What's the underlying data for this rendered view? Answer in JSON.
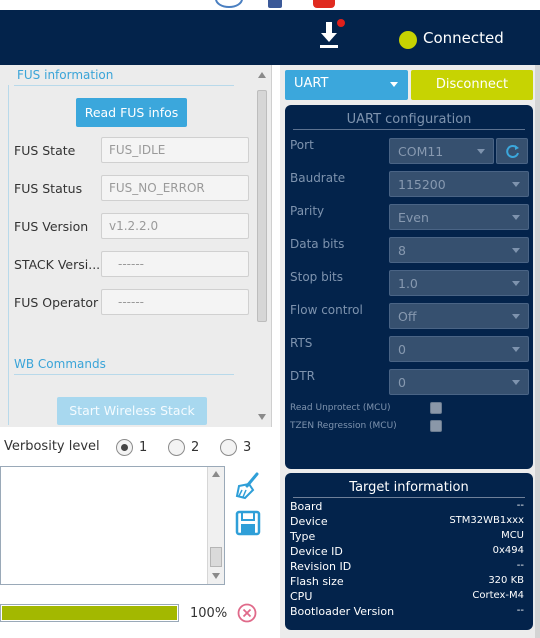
{
  "header": {
    "connection_status": "Connected",
    "status_color": "#c7d302",
    "download_icon": "download-icon"
  },
  "fus": {
    "section_title": "FUS information",
    "read_button": "Read FUS infos",
    "fields": [
      {
        "label": "FUS State",
        "value": "FUS_IDLE"
      },
      {
        "label": "FUS Status",
        "value": "FUS_NO_ERROR"
      },
      {
        "label": "FUS Version",
        "value": "v1.2.2.0"
      },
      {
        "label": "STACK Versi...",
        "value": "------"
      },
      {
        "label": "FUS Operator",
        "value": "------"
      }
    ]
  },
  "wb": {
    "section_title": "WB Commands",
    "start_button": "Start Wireless Stack"
  },
  "verbosity": {
    "label": "Verbosity level",
    "options": [
      "1",
      "2",
      "3"
    ],
    "selected": "1"
  },
  "progress": {
    "percent_text": "100%",
    "fraction": 1.0,
    "color": "#a3b800"
  },
  "connection": {
    "interface": "UART",
    "disconnect_button": "Disconnect"
  },
  "uart": {
    "title": "UART configuration",
    "fields": [
      {
        "label": "Port",
        "value": "COM11"
      },
      {
        "label": "Baudrate",
        "value": "115200"
      },
      {
        "label": "Parity",
        "value": "Even"
      },
      {
        "label": "Data bits",
        "value": "8"
      },
      {
        "label": "Stop bits",
        "value": "1.0"
      },
      {
        "label": "Flow control",
        "value": "Off"
      },
      {
        "label": "RTS",
        "value": "0"
      },
      {
        "label": "DTR",
        "value": "0"
      }
    ],
    "checkboxes": [
      {
        "label": "Read Unprotect (MCU)",
        "checked": false
      },
      {
        "label": "TZEN Regression (MCU)",
        "checked": false
      }
    ]
  },
  "target": {
    "title": "Target information",
    "rows": [
      {
        "key": "Board",
        "value": "--"
      },
      {
        "key": "Device",
        "value": "STM32WB1xxx"
      },
      {
        "key": "Type",
        "value": "MCU"
      },
      {
        "key": "Device ID",
        "value": "0x494"
      },
      {
        "key": "Revision ID",
        "value": "--"
      },
      {
        "key": "Flash size",
        "value": "320 KB"
      },
      {
        "key": "CPU",
        "value": "Cortex-M4"
      },
      {
        "key": "Bootloader Version",
        "value": "--"
      }
    ]
  },
  "colors": {
    "navy": "#03234b",
    "accent_blue": "#3ba7dc",
    "accent_green": "#c7d302"
  }
}
